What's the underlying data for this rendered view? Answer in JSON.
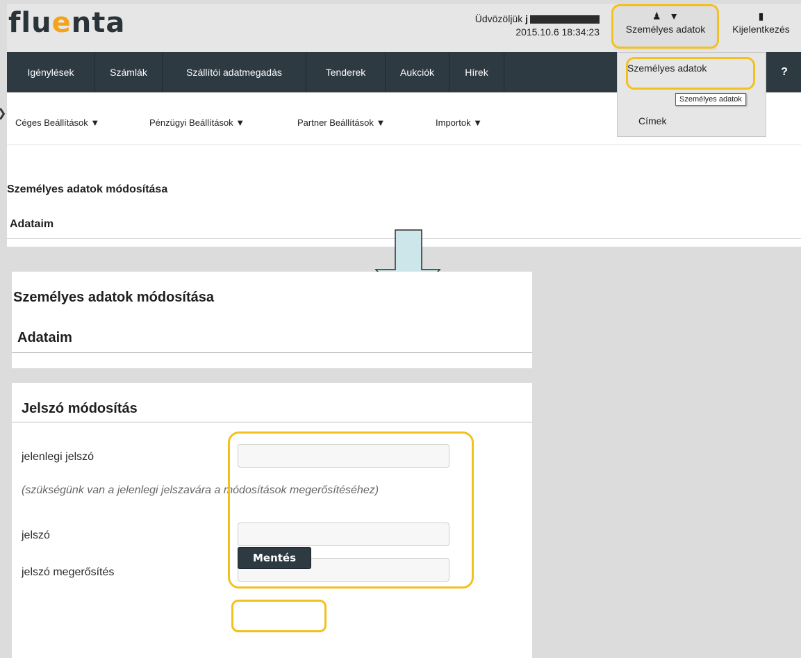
{
  "colors": {
    "highlight": "#f2c120",
    "nav_bg": "#2d3a42",
    "logo_accent": "#f3a31a",
    "page_bg": "#dcdcdc"
  },
  "header": {
    "logo_prefix": "flu",
    "logo_accent": "e",
    "logo_suffix": "nta",
    "welcome_text": "Üdvözöljük",
    "datetime": "2015.10.6 18:34:23",
    "personal_label": "Személyes adatok",
    "personal_icon": "user-icon",
    "logout_label": "Kijelentkezés",
    "logout_icon": "door-icon"
  },
  "main_nav": [
    "Igénylések",
    "Számlák",
    "Szállítói adatmegadás",
    "Tenderek",
    "Aukciók",
    "Hírek"
  ],
  "help_label": "?",
  "sub_nav": [
    "Céges Beállítások ▼",
    "Pénzügyi Beállítások ▼",
    "Partner Beállítások ▼",
    "Importok ▼"
  ],
  "dropdown": {
    "item1": "Személyes adatok",
    "item2": "Címek"
  },
  "tooltip": "Személyes adatok",
  "top_section": {
    "title": "Személyes adatok módosítása",
    "subtitle": "Adataim"
  },
  "mid_section": {
    "title": "Személyes adatok módosítása",
    "subtitle": "Adataim"
  },
  "password_form": {
    "title": "Jelszó módosítás",
    "current_label": "jelenlegi jelszó",
    "hint": "(szükségünk van a jelenlegi jelszavára a módosítások megerősítéséhez)",
    "new_label": "jelszó",
    "confirm_label": "jelszó megerősítés",
    "current_value": "",
    "new_value": "",
    "confirm_value": "",
    "save_label": "Mentés"
  }
}
